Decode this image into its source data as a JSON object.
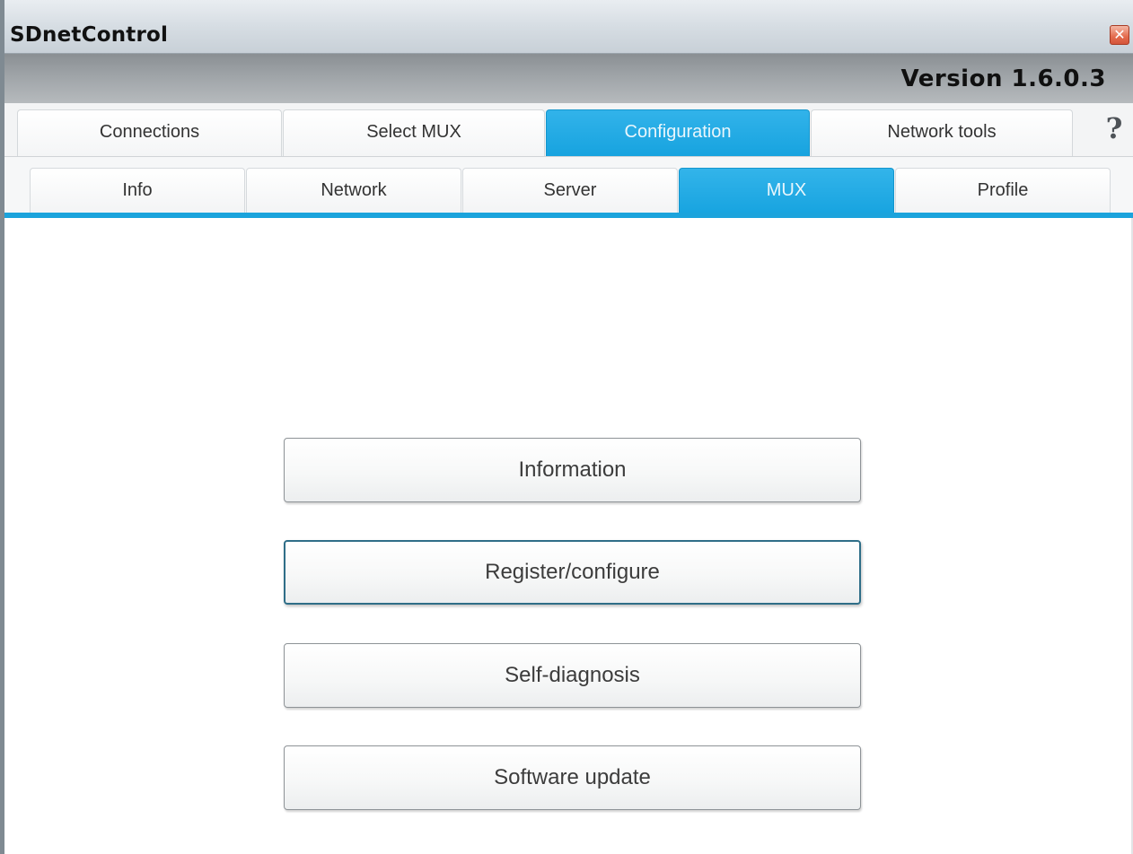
{
  "window": {
    "title": "SDnetControl",
    "close_glyph": "✕",
    "version": "Version 1.6.0.3"
  },
  "main_tabs": [
    {
      "label": "Connections",
      "active": false
    },
    {
      "label": "Select MUX",
      "active": false
    },
    {
      "label": "Configuration",
      "active": true
    },
    {
      "label": "Network tools",
      "active": false
    }
  ],
  "help": {
    "glyph": "?",
    "icon": "help-icon"
  },
  "sub_tabs": [
    {
      "label": "Info",
      "active": false
    },
    {
      "label": "Network",
      "active": false
    },
    {
      "label": "Server",
      "active": false
    },
    {
      "label": "MUX",
      "active": true
    },
    {
      "label": "Profile",
      "active": false
    }
  ],
  "actions": [
    {
      "label": "Information",
      "focused": false
    },
    {
      "label": "Register/configure",
      "focused": true
    },
    {
      "label": "Self-diagnosis",
      "focused": false
    },
    {
      "label": "Software update",
      "focused": false
    }
  ],
  "colors": {
    "accent": "#18a4e0",
    "active_tab_text": "#e9f6fc",
    "version_bar": "#9da2a6"
  }
}
